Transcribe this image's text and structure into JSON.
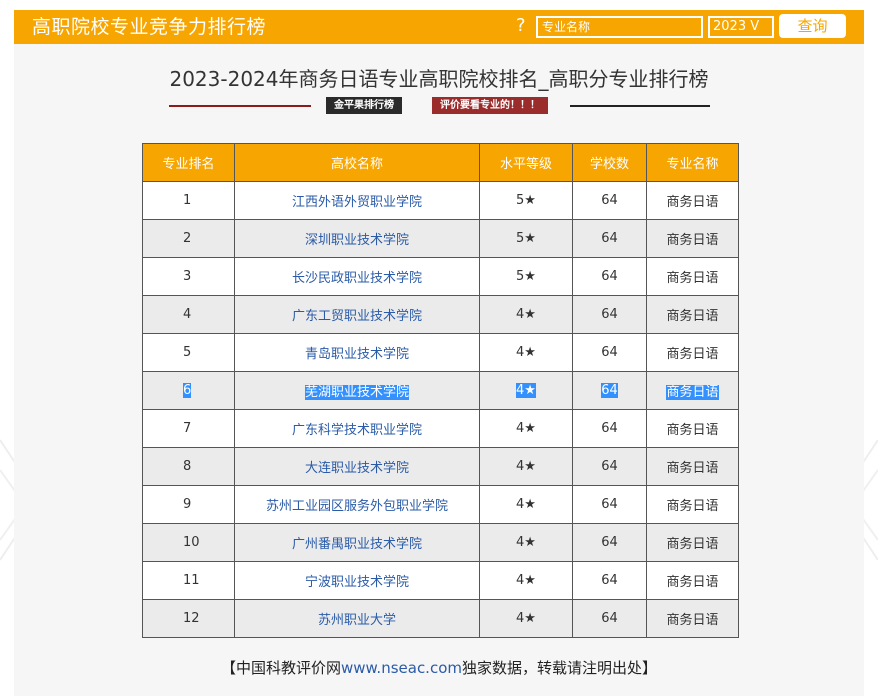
{
  "header": {
    "site_title": "高职院校专业竞争力排行榜",
    "help_icon": "?",
    "search_placeholder": "专业名称",
    "year": "2023 V",
    "query_label": "查询"
  },
  "page": {
    "title": "2023-2024年商务日语专业高职院校排名_高职分专业排行榜",
    "tag_dark": "金平果排行榜",
    "tag_red": "评价要看专业的！！！"
  },
  "table": {
    "headers": [
      "专业排名",
      "高校名称",
      "水平等级",
      "学校数",
      "专业名称"
    ],
    "rows": [
      {
        "rank": "1",
        "school": "江西外语外贸职业学院",
        "level": "5★",
        "count": "64",
        "major": "商务日语"
      },
      {
        "rank": "2",
        "school": "深圳职业技术学院",
        "level": "5★",
        "count": "64",
        "major": "商务日语"
      },
      {
        "rank": "3",
        "school": "长沙民政职业技术学院",
        "level": "5★",
        "count": "64",
        "major": "商务日语"
      },
      {
        "rank": "4",
        "school": "广东工贸职业技术学院",
        "level": "4★",
        "count": "64",
        "major": "商务日语"
      },
      {
        "rank": "5",
        "school": "青岛职业技术学院",
        "level": "4★",
        "count": "64",
        "major": "商务日语"
      },
      {
        "rank": "6",
        "school": "芜湖职业技术学院",
        "level": "4★",
        "count": "64",
        "major": "商务日语"
      },
      {
        "rank": "7",
        "school": "广东科学技术职业学院",
        "level": "4★",
        "count": "64",
        "major": "商务日语"
      },
      {
        "rank": "8",
        "school": "大连职业技术学院",
        "level": "4★",
        "count": "64",
        "major": "商务日语"
      },
      {
        "rank": "9",
        "school": "苏州工业园区服务外包职业学院",
        "level": "4★",
        "count": "64",
        "major": "商务日语"
      },
      {
        "rank": "10",
        "school": "广州番禺职业技术学院",
        "level": "4★",
        "count": "64",
        "major": "商务日语"
      },
      {
        "rank": "11",
        "school": "宁波职业技术学院",
        "level": "4★",
        "count": "64",
        "major": "商务日语"
      },
      {
        "rank": "12",
        "school": "苏州职业大学",
        "level": "4★",
        "count": "64",
        "major": "商务日语"
      }
    ]
  },
  "footer": {
    "prefix": "【中国科教评价网",
    "link": "www.nseac.com",
    "suffix": "独家数据，转载请注明出处】"
  },
  "colors": {
    "accent": "#f7a500",
    "link": "#2a5ba8",
    "selection": "#3390ff"
  }
}
